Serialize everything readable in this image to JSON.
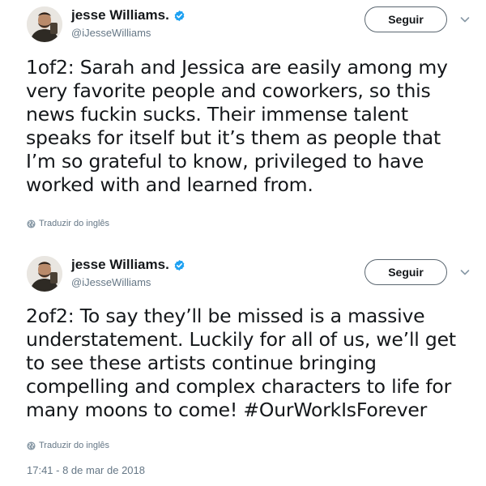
{
  "colors": {
    "verified": "#1da1f2",
    "text": "#14171a",
    "secondary": "#657786"
  },
  "tweets": [
    {
      "author": {
        "name": "jesse Williams.",
        "handle": "@iJesseWilliams",
        "verified_icon": "verified-badge-icon"
      },
      "follow_label": "Seguir",
      "text_lines": [
        "1of2: Sarah and Jessica are easily among my",
        "very favorite people and coworkers, so this",
        "news fuckin sucks. Their immense talent",
        "speaks for itself but it’s them as people that",
        "I’m so grateful to know, privileged to have",
        "worked with and learned from."
      ],
      "translate_label": "Traduzir do inglês"
    },
    {
      "author": {
        "name": "jesse Williams.",
        "handle": "@iJesseWilliams",
        "verified_icon": "verified-badge-icon"
      },
      "follow_label": "Seguir",
      "text_lines": [
        "2of2: To say they’ll be missed is a massive",
        "understatement. Luckily for all of us, we’ll get",
        "to see these artists continue bringing",
        "compelling and complex characters to life for",
        "many moons to come! #OurWorkIsForever"
      ],
      "translate_label": "Traduzir do inglês",
      "timestamp": "17:41 - 8 de mar de 2018"
    }
  ]
}
